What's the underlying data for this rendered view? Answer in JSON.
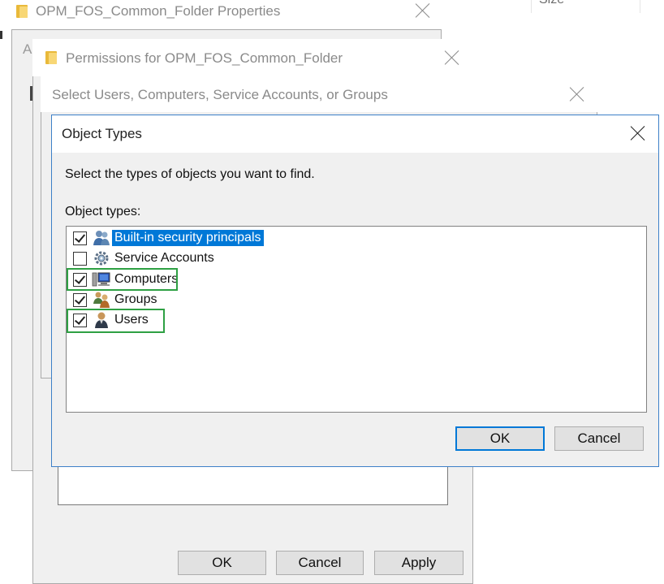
{
  "background": {
    "column_header": "Size"
  },
  "properties_window": {
    "title": "OPM_FOS_Common_Folder Properties",
    "tab_letter": "A"
  },
  "permissions_window": {
    "title": "Permissions for OPM_FOS_Common_Folder",
    "buttons": {
      "ok": "OK",
      "cancel": "Cancel",
      "apply": "Apply"
    }
  },
  "select_window": {
    "title": "Select Users, Computers, Service Accounts, or Groups"
  },
  "object_types_dialog": {
    "title": "Object Types",
    "description": "Select the types of objects you want to find.",
    "list_label": "Object types:",
    "items": [
      {
        "label": "Built-in security principals",
        "checked": true,
        "selected": true,
        "icon": "security-principals-icon",
        "highlighted": false
      },
      {
        "label": "Service Accounts",
        "checked": false,
        "selected": false,
        "icon": "service-accounts-icon",
        "highlighted": false
      },
      {
        "label": "Computers",
        "checked": true,
        "selected": false,
        "icon": "computer-icon",
        "highlighted": true
      },
      {
        "label": "Groups",
        "checked": true,
        "selected": false,
        "icon": "groups-icon",
        "highlighted": false
      },
      {
        "label": "Users",
        "checked": true,
        "selected": false,
        "icon": "user-icon",
        "highlighted": true
      }
    ],
    "buttons": {
      "ok": "OK",
      "cancel": "Cancel"
    },
    "colors": {
      "selection": "#0078d7",
      "highlight_frame": "#2ea043",
      "dialog_border": "#3d80c8"
    }
  }
}
